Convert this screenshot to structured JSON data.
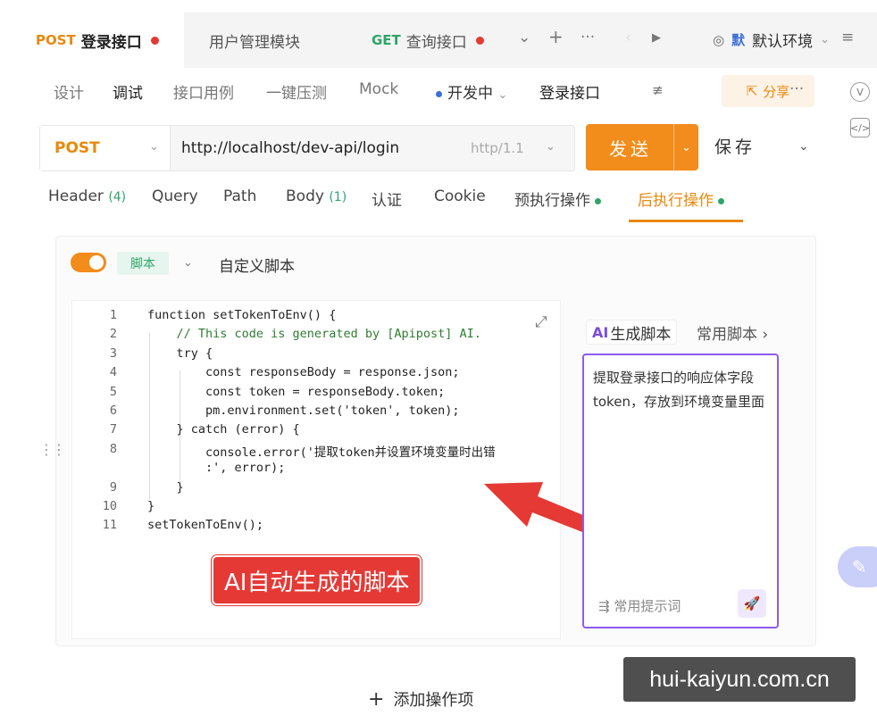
{
  "tabs": [
    {
      "method": "POST",
      "label": "登录接口",
      "unsaved": true
    },
    {
      "method": "",
      "label": "用户管理模块",
      "unsaved": false
    },
    {
      "method": "GET",
      "label": "查询接口",
      "unsaved": true
    }
  ],
  "environment": {
    "badge": "默",
    "label": "默认环境"
  },
  "subtabs": [
    "设计",
    "调试",
    "接口用例",
    "一键压测",
    "Mock"
  ],
  "status": "开发中",
  "api_name": "登录接口",
  "share_label": "分享",
  "request": {
    "method": "POST",
    "url": "http://localhost/dev-api/login",
    "protocol": "http/1.1",
    "send_label": "发送",
    "save_label": "保存"
  },
  "request_tabs": [
    {
      "label": "Header",
      "count": "(4)"
    },
    {
      "label": "Query",
      "count": ""
    },
    {
      "label": "Path",
      "count": ""
    },
    {
      "label": "Body",
      "count": "(1)"
    },
    {
      "label": "认证",
      "count": ""
    },
    {
      "label": "Cookie",
      "count": ""
    },
    {
      "label": "预执行操作",
      "count": ""
    },
    {
      "label": "后执行操作",
      "count": ""
    }
  ],
  "script": {
    "type_badge": "脚本",
    "title": "自定义脚本",
    "line_numbers": [
      "1",
      "2",
      "3",
      "4",
      "5",
      "6",
      "7",
      "8",
      "",
      "9",
      "10",
      "11"
    ],
    "code_lines": [
      "function setTokenToEnv() {",
      "    // This code is generated by [Apipost] AI.",
      "    try {",
      "        const responseBody = response.json;",
      "        const token = responseBody.token;",
      "        pm.environment.set('token', token);",
      "    } catch (error) {",
      "        console.error('提取token并设置环境变量时出错",
      "        :', error);",
      "    }",
      "}",
      "setTokenToEnv();"
    ]
  },
  "ai_panel": {
    "tab_ai_mark": "AI",
    "tab_ai": "生成脚本",
    "tab_common": "常用脚本",
    "prompt": "提取登录接口的响应体字段token，存放到环境变量里面",
    "hint": "常用提示词"
  },
  "annotation": "AI自动生成的脚本",
  "add_action": "添加操作项",
  "watermark": "hui-kaiyun.com.cn",
  "colors": {
    "accent": "#f28c1b",
    "ai": "#8a5cf0",
    "annotation": "#e53935",
    "success": "#2fa56a"
  }
}
